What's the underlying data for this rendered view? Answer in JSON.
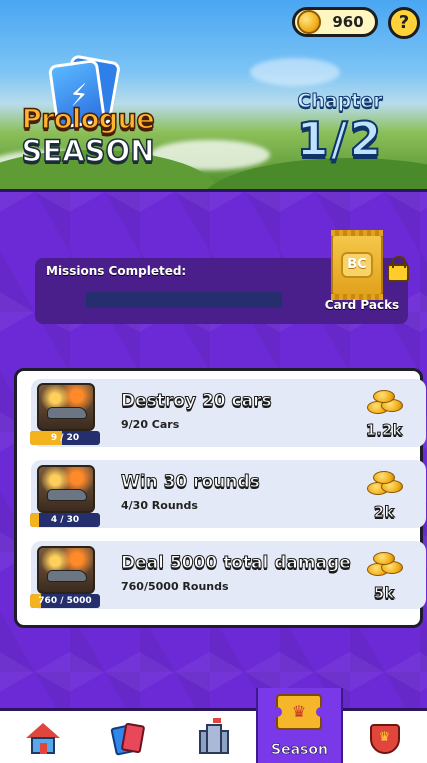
{
  "header": {
    "coins": "960",
    "help_label": "?",
    "season_title_line1": "Prologue",
    "season_title_line2": "SEASON",
    "chapter_label": "Chapter",
    "chapter_value": "1/2"
  },
  "missions_summary": {
    "label": "Missions Completed:",
    "progress": 0.0,
    "card_pack_logo": "BC",
    "card_pack_label": "Card Packs",
    "card_pack_locked": true
  },
  "missions": [
    {
      "title": "Destroy 20 cars",
      "subtitle": "9/20 Cars",
      "progress_label": "9 / 20",
      "progress": 0.45,
      "reward": "1.2k"
    },
    {
      "title": "Win 30 rounds",
      "subtitle": "4/30 Rounds",
      "progress_label": "4 / 30",
      "progress": 0.133,
      "reward": "2k"
    },
    {
      "title": "Deal 5000 total damage",
      "subtitle": "760/5000 Rounds",
      "progress_label": "760 / 5000",
      "progress": 0.152,
      "reward": "5k"
    }
  ],
  "nav": {
    "items": [
      {
        "name": "home",
        "icon": "house-icon"
      },
      {
        "name": "cards",
        "icon": "cards-icon"
      },
      {
        "name": "castle",
        "icon": "castle-icon"
      },
      {
        "name": "season",
        "icon": "ticket-icon",
        "label": "Season",
        "active": true
      },
      {
        "name": "clan",
        "icon": "shield-icon"
      }
    ]
  },
  "colors": {
    "purple_bg": "#6c2ad6",
    "progress_track": "#262f6e",
    "progress_fill": "#f3b31e",
    "nav_active": "#7a39e8"
  }
}
